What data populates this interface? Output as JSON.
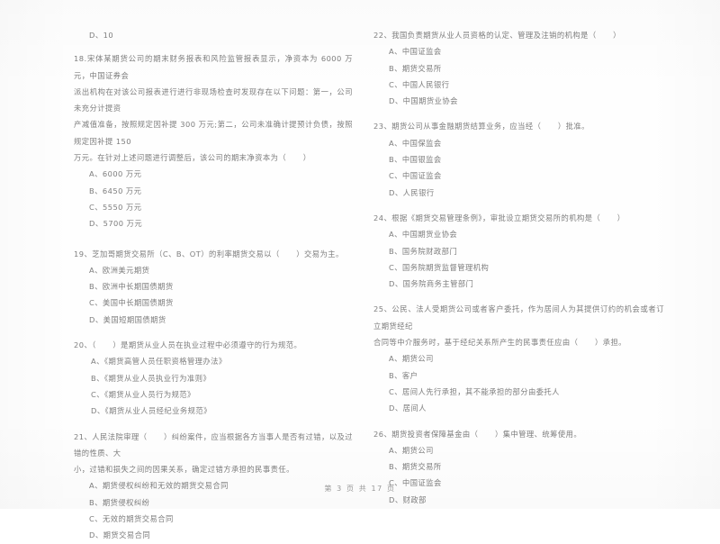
{
  "document": {
    "footer": "第 3 页 共 17 页"
  },
  "left_column": {
    "orphan_option": "D、10",
    "questions": [
      {
        "stem": "18.宋体某期货公司的期末财务报表和风险监管报表显示，净资本为 6000 万元，中国证券会\n派出机构在对该公司报表进行进行非现场检查时发现存在以下问题：第一，公司未充分计提资\n产减值准备，按照规定因补提 300 万元;第二，公司未准确计提预计负债，按照规定因补提 150\n万元。在针对上述问题进行调整后，该公司的期末净资本为（      ）",
        "options": [
          "A、6000 万元",
          "B、6450 万元",
          "C、5550 万元",
          "D、5700 万元"
        ]
      },
      {
        "stem": "19、芝加哥期货交易所（C、B、OT）的利率期货交易以（      ）交易为主。",
        "options": [
          "A、欧洲美元期货",
          "B、欧洲中长期国债期货",
          "C、美国中长期国债期货",
          "D、美国短期国债期货"
        ]
      },
      {
        "stem": "20、（      ）是期货从业人员在执业过程中必须遵守的行为规范。",
        "options": [
          "A、《期货高管人员任职资格管理办法》",
          "B、《期货从业人员执业行为准则》",
          "C、《期货从业人员行为规范》",
          "D、《期货从业人员经纪业务规范》"
        ]
      },
      {
        "stem": "21、人民法院审理（      ）纠纷案件，应当根据各方当事人是否有过错，以及过错的性质、大\n小，过错和损失之间的因果关系，确定过错方承担的民事责任。",
        "options": [
          "A、期货侵权纠纷和无效的期货交易合同",
          "B、期货侵权纠纷",
          "C、无效的期货交易合同",
          "D、期货交易合同"
        ]
      }
    ]
  },
  "right_column": {
    "questions": [
      {
        "stem": "22、我国负责期货从业人员资格的认定、管理及注销的机构是（      ）",
        "options": [
          "A、中国证监会",
          "B、期货交易所",
          "C、中国人民银行",
          "D、中国期货业协会"
        ]
      },
      {
        "stem": "23、期货公司从事金融期货结算业务，应当经（      ）批准。",
        "options": [
          "A、中国保监会",
          "B、中国银监会",
          "C、中国证监会",
          "D、人民银行"
        ]
      },
      {
        "stem": "24、根据《期货交易管理条例》，审批设立期货交易所的机构是（      ）",
        "options": [
          "A、中国期货业协会",
          "B、国务院财政部门",
          "C、国务院期货监督管理机构",
          "D、国务院商务主管部门"
        ]
      },
      {
        "stem": "25、公民、法人受期货公司或者客户委托，作为居间人为其提供订约的机会或者订立期货经纪\n合同等中介服务时，基于经纪关系所产生的民事责任应由（      ）承担。",
        "options": [
          "A、期货公司",
          "B、客户",
          "C、居间人先行承担，其不能承担的部分由委托人",
          "D、居间人"
        ]
      },
      {
        "stem": "26、期货投资者保障基金由（      ）集中管理、统筹使用。",
        "options": [
          "A、期货公司",
          "B、期货交易所",
          "C、中国证监会",
          "D、财政部"
        ]
      }
    ]
  }
}
